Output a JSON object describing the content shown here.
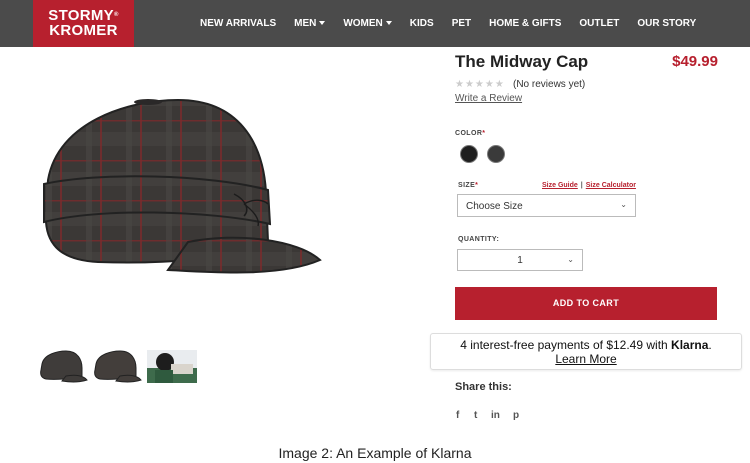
{
  "brand": {
    "line1": "STORMY",
    "line2": "KROMER",
    "mark": "®"
  },
  "nav": [
    {
      "label": "NEW ARRIVALS",
      "dropdown": false
    },
    {
      "label": "MEN",
      "dropdown": true
    },
    {
      "label": "WOMEN",
      "dropdown": true
    },
    {
      "label": "KIDS",
      "dropdown": false
    },
    {
      "label": "PET",
      "dropdown": false
    },
    {
      "label": "HOME & GIFTS",
      "dropdown": false
    },
    {
      "label": "OUTLET",
      "dropdown": false
    },
    {
      "label": "OUR STORY",
      "dropdown": false
    }
  ],
  "product": {
    "title": "The Midway Cap",
    "price": "$49.99",
    "stars": "★★★★★",
    "reviews": "(No reviews yet)",
    "write_review": "Write a Review"
  },
  "options": {
    "color_label": "COLOR",
    "required_mark": "*",
    "size_label": "SIZE",
    "size_guide": "Size Guide",
    "size_sep": "|",
    "size_calculator": "Size Calculator",
    "size_value": "Choose Size",
    "quantity_label": "QUANTITY:",
    "quantity_value": "1",
    "chevron": "⌄"
  },
  "cart": {
    "add_label": "ADD TO CART"
  },
  "klarna": {
    "text": "4 interest-free payments of $12.49 with",
    "brand": "Klarna",
    "dot": ".",
    "learn_more": "Learn More"
  },
  "share": {
    "title": "Share this:",
    "icons": [
      "facebook-icon",
      "twitter-icon",
      "linkedin-icon",
      "pinterest-icon"
    ],
    "glyphs": [
      "f",
      "t",
      "in",
      "p"
    ]
  },
  "caption": "Image 2: An Example of Klarna",
  "colors": {
    "accent": "#b7202e",
    "header": "#4b4b4b",
    "swatch_1": "#1f1f1f",
    "swatch_2": "#3a3a3a"
  }
}
